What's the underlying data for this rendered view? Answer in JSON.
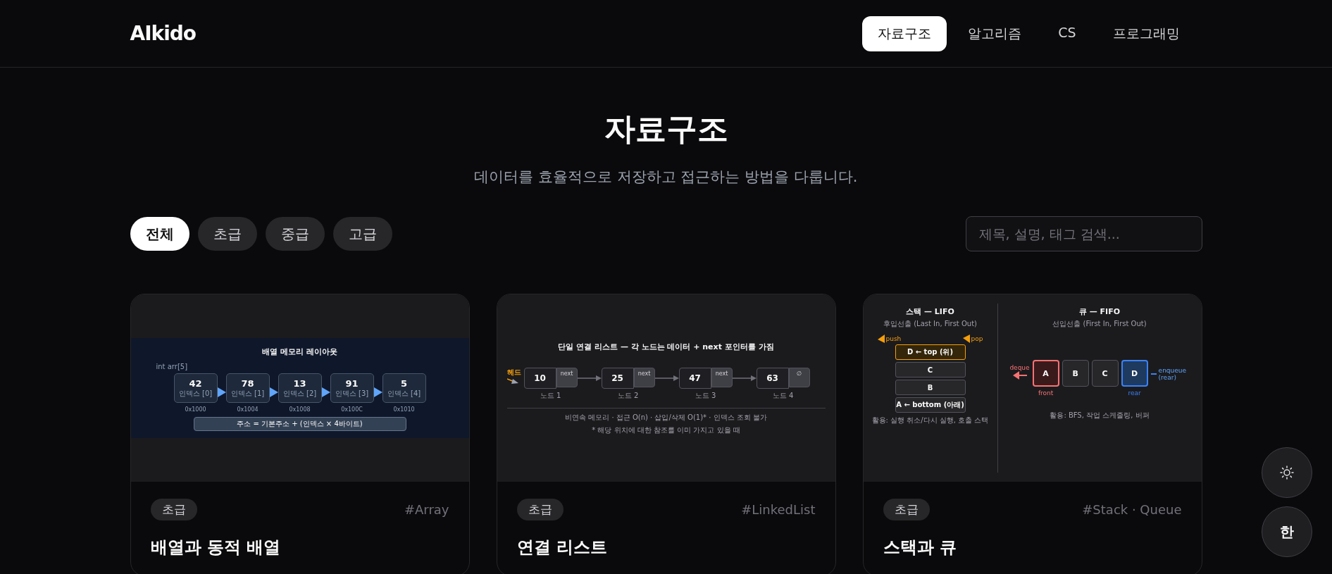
{
  "header": {
    "logo": "AIkido",
    "nav": [
      {
        "label": "자료구조",
        "selected": true
      },
      {
        "label": "알고리즘",
        "selected": false
      },
      {
        "label": "CS",
        "selected": false
      },
      {
        "label": "프로그래밍",
        "selected": false
      }
    ]
  },
  "hero": {
    "title": "자료구조",
    "subtitle": "데이터를 효율적으로 저장하고 접근하는 방법을 다룹니다."
  },
  "filters": [
    {
      "label": "전체",
      "selected": true
    },
    {
      "label": "초급",
      "selected": false
    },
    {
      "label": "중급",
      "selected": false
    },
    {
      "label": "고급",
      "selected": false
    }
  ],
  "search": {
    "placeholder": "제목, 설명, 태그 검색..."
  },
  "cards": [
    {
      "difficulty": "초급",
      "tag": "#Array",
      "title": "배열과 동적 배열",
      "diagram": {
        "kind": "array",
        "title": "배열 메모리 레이아웃",
        "declaration": "int arr[5]",
        "formula": "주소 = 기본주소 + (인덱스 × 4바이트)",
        "cells": [
          {
            "value": "42",
            "index": "인덱스 [0]",
            "address": "0x1000"
          },
          {
            "value": "78",
            "index": "인덱스 [1]",
            "address": "0x1004"
          },
          {
            "value": "13",
            "index": "인덱스 [2]",
            "address": "0x1008"
          },
          {
            "value": "91",
            "index": "인덱스 [3]",
            "address": "0x100C"
          },
          {
            "value": "5",
            "index": "인덱스 [4]",
            "address": "0x1010"
          }
        ]
      }
    },
    {
      "difficulty": "초급",
      "tag": "#LinkedList",
      "title": "연결 리스트",
      "diagram": {
        "kind": "linked_list",
        "title": "단일 연결 리스트 — 각 노드는 데이터 + next 포인터를 가짐",
        "head": "헤드",
        "nodes": [
          {
            "value": "10",
            "pointer": "next",
            "label": "노드 1"
          },
          {
            "value": "25",
            "pointer": "next",
            "label": "노드 2"
          },
          {
            "value": "47",
            "pointer": "next",
            "label": "노드 3"
          },
          {
            "value": "63",
            "pointer": "∅",
            "label": "노드 4"
          }
        ],
        "notes": [
          "비연속 메모리 · 접근 O(n) · 삽입/삭제 O(1)* · 인덱스 조회 불가",
          "* 해당 위치에 대한 참조를 이미 가지고 있을 때"
        ]
      }
    },
    {
      "difficulty": "초급",
      "tag": "#Stack · Queue",
      "title": "스택과 큐",
      "diagram": {
        "kind": "stack_queue",
        "stack": {
          "title": "스택 — LIFO",
          "subtitle": "후입선출 (Last In, First Out)",
          "push": "push",
          "pop": "pop",
          "usage": "활용: 실행 취소/다시 실행, 호출 스택",
          "items": [
            {
              "label": "D ← top (위)",
              "kind": "top"
            },
            {
              "label": "C",
              "kind": "plain"
            },
            {
              "label": "B",
              "kind": "plain"
            },
            {
              "label": "A ← bottom (아래)",
              "kind": "plain"
            }
          ]
        },
        "queue": {
          "title": "큐 — FIFO",
          "subtitle": "선입선출 (First In, First Out)",
          "dequeue": "deque",
          "enqueue": "enqueue (rear)",
          "usage": "활용: BFS, 작업 스케줄링, 버퍼",
          "items": [
            {
              "label": "A",
              "kind": "front",
              "caption": "front"
            },
            {
              "label": "B",
              "kind": "plain"
            },
            {
              "label": "C",
              "kind": "plain"
            },
            {
              "label": "D",
              "kind": "rear",
              "caption": "rear"
            }
          ]
        }
      }
    }
  ],
  "floating_buttons": [
    {
      "kind": "theme"
    },
    {
      "kind": "language",
      "label": "한"
    }
  ]
}
